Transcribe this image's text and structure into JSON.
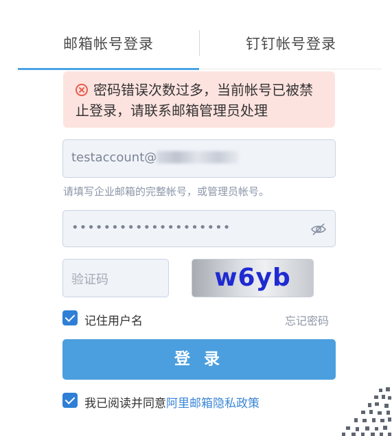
{
  "tabs": {
    "email_login": "邮箱帐号登录",
    "dingtalk_login": "钉钉帐号登录"
  },
  "error": {
    "message": "密码错误次数过多，当前帐号已被禁止登录，请联系邮箱管理员处理"
  },
  "email_field": {
    "value_prefix": "testaccount@"
  },
  "hint": "请填写企业邮箱的完整帐号，或管理员帐号。",
  "password_field": {
    "masked_value": "••••••••••••••••••••"
  },
  "captcha": {
    "placeholder": "验证码",
    "image_text": "w6yb"
  },
  "remember": {
    "label": "记住用户名",
    "checked": true
  },
  "forgot_password": "忘记密码",
  "login_button": "登 录",
  "agreement": {
    "prefix": "我已阅读并同意",
    "link": "阿里邮箱隐私政策",
    "checked": true
  },
  "colors": {
    "accent": "#4b9fde",
    "error_bg": "#fde3df",
    "error_icon": "#e85a4b",
    "link": "#3b86d6",
    "captcha_text": "#1f2ad1"
  }
}
